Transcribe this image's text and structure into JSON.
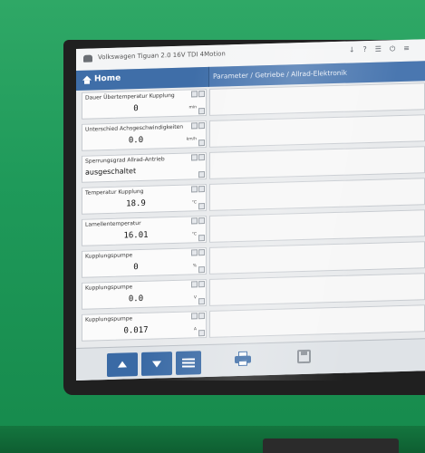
{
  "window": {
    "title": "Volkswagen Tiguan 2.0 16V TDI 4Motion",
    "icons": [
      "download-icon",
      "help-icon",
      "settings-icon",
      "power-icon",
      "menu-icon"
    ]
  },
  "nav": {
    "home_label": "Home",
    "breadcrumb": "Parameter / Getriebe / Allrad-Elektronik"
  },
  "parameters": [
    {
      "name": "Dauer Übertemperatur Kupplung",
      "value": "0",
      "unit": "min"
    },
    {
      "name": "Unterschied Achsgeschwindigkeiten",
      "value": "0.0",
      "unit": "km/h"
    },
    {
      "name": "Sperrungsgrad Allrad-Antrieb",
      "value": "ausgeschaltet",
      "unit": ""
    },
    {
      "name": "Temperatur Kupplung",
      "value": "18.9",
      "unit": "°C"
    },
    {
      "name": "Lamellentemperatur",
      "value": "16.01",
      "unit": "°C"
    },
    {
      "name": "Kupplungspumpe",
      "value": "0",
      "unit": "%"
    },
    {
      "name": "Kupplungspumpe",
      "value": "0.0",
      "unit": "V"
    },
    {
      "name": "Kupplungspumpe",
      "value": "0.017",
      "unit": "A"
    }
  ],
  "toolbar": {
    "buttons": [
      "scroll-up",
      "scroll-down",
      "list-view",
      "print",
      "save"
    ]
  },
  "colors": {
    "accent": "#3f6ea8",
    "device_green": "#1f9a5a"
  }
}
